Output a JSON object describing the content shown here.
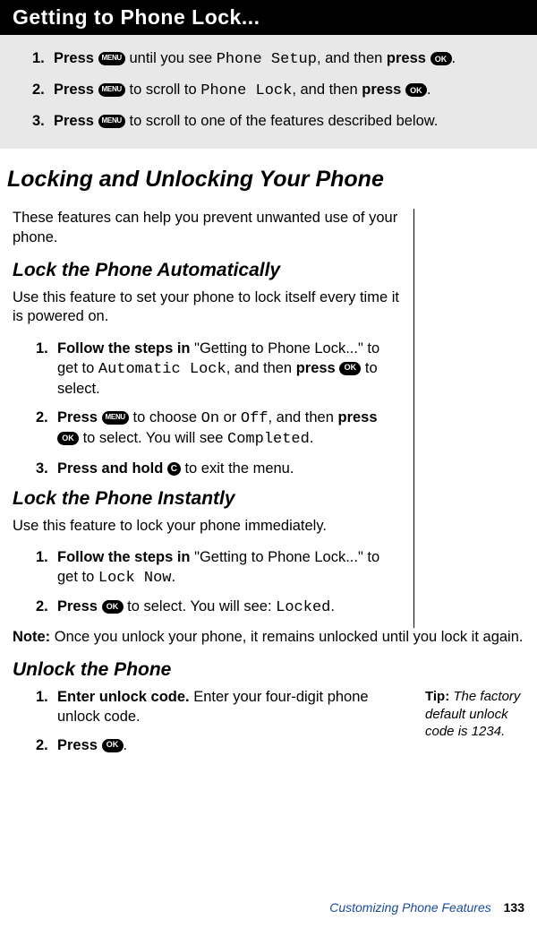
{
  "header": {
    "title": "Getting to Phone Lock..."
  },
  "gray": {
    "s1": {
      "num": "1.",
      "a": "Press ",
      "b": " until you see ",
      "mono": "Phone Setup",
      "c": ", and then ",
      "d": "press ",
      "e": "."
    },
    "s2": {
      "num": "2.",
      "a": "Press ",
      "b": " to scroll to ",
      "mono": "Phone Lock",
      "c": ", and then ",
      "d": "press ",
      "e": "."
    },
    "s3": {
      "num": "3.",
      "a": "Press ",
      "b": " to scroll to one of the features described below."
    }
  },
  "main": {
    "h2": "Locking and Unlocking Your Phone",
    "intro": "These features can help you prevent unwanted use of your phone.",
    "auto": {
      "h3": "Lock the Phone Automatically",
      "desc": "Use this feature to set your phone to lock itself every time it is powered on.",
      "s1": {
        "num": "1.",
        "a": "Follow the steps in ",
        "b": "\"Getting to Phone Lock...\" to get to ",
        "mono": "Automatic Lock",
        "c": ", and then ",
        "d": "press ",
        "e": " to select."
      },
      "s2": {
        "num": "2.",
        "a": "Press ",
        "b": " to choose ",
        "mono1": "On",
        "c": " or ",
        "mono2": "Off",
        "d": ", and then ",
        "e": "press ",
        "f": " to select. You will see ",
        "mono3": "Completed",
        "g": "."
      },
      "s3": {
        "num": "3.",
        "a": "Press and hold ",
        "b": " to exit the menu."
      }
    },
    "instant": {
      "h3": "Lock the Phone Instantly",
      "desc": "Use this feature to lock your phone immediately.",
      "s1": {
        "num": "1.",
        "a": "Follow the steps in ",
        "b": "\"Getting to Phone Lock...\" to get to ",
        "mono": "Lock Now",
        "c": "."
      },
      "s2": {
        "num": "2.",
        "a": "Press ",
        "b": " to select. You will see: ",
        "mono": "Locked",
        "c": "."
      },
      "note": {
        "a": "Note:",
        "b": " Once you unlock your phone, it remains unlocked until you lock it again."
      }
    },
    "unlock": {
      "h3": "Unlock the Phone",
      "s1": {
        "num": "1.",
        "a": "Enter unlock code.",
        "b": " Enter your four-digit phone unlock code."
      },
      "s2": {
        "num": "2.",
        "a": "Press ",
        "b": "."
      },
      "tip": {
        "label": "Tip:",
        "text": " The factory default unlock code is 1234."
      }
    }
  },
  "icons": {
    "menu": "MENU",
    "ok": "OK",
    "c": "C"
  },
  "footer": {
    "section": "Customizing Phone Features",
    "page": "133"
  }
}
